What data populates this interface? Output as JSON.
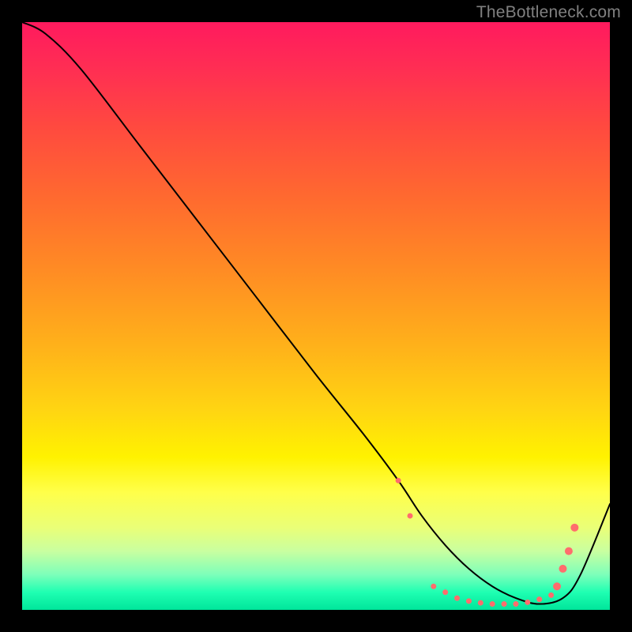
{
  "watermark": "TheBottleneck.com",
  "chart_data": {
    "type": "line",
    "title": "",
    "xlabel": "",
    "ylabel": "",
    "xlim": [
      0,
      100
    ],
    "ylim": [
      0,
      100
    ],
    "grid": false,
    "legend": false,
    "series": [
      {
        "name": "bottleneck-curve",
        "x": [
          0,
          4,
          10,
          20,
          30,
          40,
          50,
          58,
          64,
          68,
          72,
          76,
          80,
          84,
          88,
          92,
          95,
          100
        ],
        "y": [
          100,
          98,
          92,
          79,
          66,
          53,
          40,
          30,
          22,
          16,
          11,
          7,
          4,
          2,
          1,
          2,
          6,
          18
        ],
        "stroke": "#000000",
        "stroke_width": 2
      }
    ],
    "markers": {
      "name": "highlight-segment",
      "color": "#ff6d6d",
      "radius_small": 3.5,
      "radius_large": 5,
      "points": [
        {
          "x": 64,
          "y": 22,
          "r": "small"
        },
        {
          "x": 66,
          "y": 16,
          "r": "small"
        },
        {
          "x": 70,
          "y": 4,
          "r": "small"
        },
        {
          "x": 72,
          "y": 3,
          "r": "small"
        },
        {
          "x": 74,
          "y": 2,
          "r": "small"
        },
        {
          "x": 76,
          "y": 1.5,
          "r": "small"
        },
        {
          "x": 78,
          "y": 1.2,
          "r": "small"
        },
        {
          "x": 80,
          "y": 1,
          "r": "small"
        },
        {
          "x": 82,
          "y": 1,
          "r": "small"
        },
        {
          "x": 84,
          "y": 1,
          "r": "small"
        },
        {
          "x": 86,
          "y": 1.3,
          "r": "small"
        },
        {
          "x": 88,
          "y": 1.8,
          "r": "small"
        },
        {
          "x": 90,
          "y": 2.5,
          "r": "small"
        },
        {
          "x": 91,
          "y": 4,
          "r": "large"
        },
        {
          "x": 92,
          "y": 7,
          "r": "large"
        },
        {
          "x": 93,
          "y": 10,
          "r": "large"
        },
        {
          "x": 94,
          "y": 14,
          "r": "large"
        }
      ]
    },
    "background_gradient": {
      "top": "#ff1a5e",
      "mid1": "#ff8b24",
      "mid2": "#fff200",
      "bottom": "#00e59a"
    }
  }
}
